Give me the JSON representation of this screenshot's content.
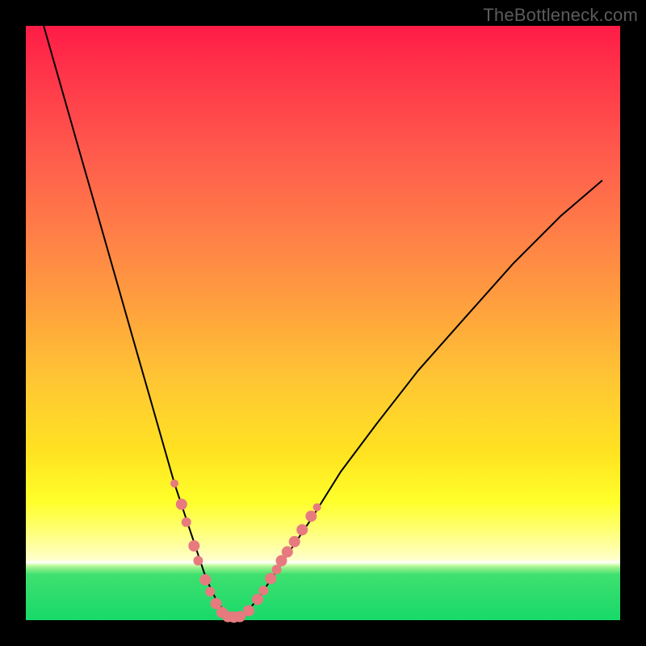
{
  "watermark": "TheBottleneck.com",
  "colors": {
    "frame": "#000000",
    "curve": "#000000",
    "marker_fill": "#e77a7f",
    "marker_stroke": "#b2474e"
  },
  "chart_data": {
    "type": "line",
    "title": "",
    "xlabel": "",
    "ylabel": "",
    "xlim": [
      0,
      100
    ],
    "ylim": [
      0,
      100
    ],
    "series": [
      {
        "name": "bottleneck-curve",
        "x": [
          3,
          5,
          7,
          9,
          11,
          13,
          15,
          17,
          19,
          21,
          23,
          25,
          26,
          27,
          28,
          29,
          30,
          31,
          32,
          33,
          34,
          35,
          36,
          37,
          39,
          41,
          44,
          48,
          53,
          59,
          66,
          74,
          82,
          90,
          97
        ],
        "y": [
          100,
          93,
          86,
          79,
          72,
          65,
          58,
          51,
          44,
          37,
          30,
          23,
          20,
          17,
          14,
          11,
          8,
          5.5,
          3.5,
          2,
          1,
          0.5,
          0.5,
          1.2,
          3.5,
          6.5,
          11,
          17,
          25,
          33,
          42,
          51,
          60,
          68,
          74
        ]
      }
    ],
    "markers": [
      {
        "x": 25.0,
        "y": 23.0,
        "r": 5
      },
      {
        "x": 26.2,
        "y": 19.5,
        "r": 7
      },
      {
        "x": 27.0,
        "y": 16.5,
        "r": 6
      },
      {
        "x": 28.3,
        "y": 12.5,
        "r": 7
      },
      {
        "x": 29.0,
        "y": 10.0,
        "r": 6
      },
      {
        "x": 30.2,
        "y": 6.8,
        "r": 7
      },
      {
        "x": 31.0,
        "y": 4.8,
        "r": 6
      },
      {
        "x": 32.0,
        "y": 2.8,
        "r": 7
      },
      {
        "x": 33.0,
        "y": 1.3,
        "r": 7
      },
      {
        "x": 34.0,
        "y": 0.6,
        "r": 7
      },
      {
        "x": 35.0,
        "y": 0.5,
        "r": 7
      },
      {
        "x": 36.0,
        "y": 0.6,
        "r": 7
      },
      {
        "x": 37.5,
        "y": 1.6,
        "r": 7
      },
      {
        "x": 39.0,
        "y": 3.5,
        "r": 7
      },
      {
        "x": 40.0,
        "y": 5.0,
        "r": 6
      },
      {
        "x": 41.2,
        "y": 7.0,
        "r": 7
      },
      {
        "x": 42.2,
        "y": 8.5,
        "r": 6
      },
      {
        "x": 43.0,
        "y": 10.0,
        "r": 7
      },
      {
        "x": 44.0,
        "y": 11.5,
        "r": 7
      },
      {
        "x": 45.2,
        "y": 13.2,
        "r": 7
      },
      {
        "x": 46.5,
        "y": 15.2,
        "r": 7
      },
      {
        "x": 48.0,
        "y": 17.5,
        "r": 7
      },
      {
        "x": 49.0,
        "y": 19.0,
        "r": 5
      }
    ]
  }
}
